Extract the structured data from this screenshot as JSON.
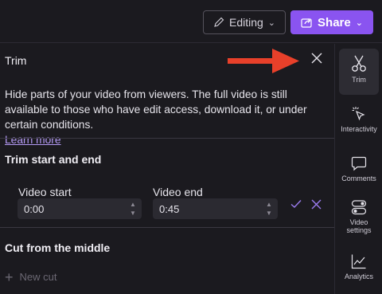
{
  "header": {
    "editing_label": "Editing",
    "share_label": "Share"
  },
  "panel": {
    "title": "Trim",
    "description": "Hide parts of your video from viewers. The full video is still available to those who have edit access, download it, or under certain conditions.",
    "learn_more": "Learn more",
    "section_trim": "Trim start and end",
    "video_start_label": "Video start",
    "video_start_value": "0:00",
    "video_end_label": "Video end",
    "video_end_value": "0:45",
    "section_cut": "Cut from the middle",
    "new_cut_label": "New cut"
  },
  "rail": {
    "items": [
      {
        "label": "Trim",
        "icon": "scissors-icon"
      },
      {
        "label": "Interactivity",
        "icon": "cursor-click-icon"
      },
      {
        "label": "Comments",
        "icon": "comment-icon"
      },
      {
        "label": "Video settings",
        "label_line1": "Video",
        "label_line2": "settings",
        "icon": "toggle-icon"
      },
      {
        "label": "Analytics",
        "icon": "chart-icon"
      }
    ]
  },
  "colors": {
    "accent": "#8a54f0",
    "arrow": "#e8402a",
    "background": "#1b1a1f"
  }
}
